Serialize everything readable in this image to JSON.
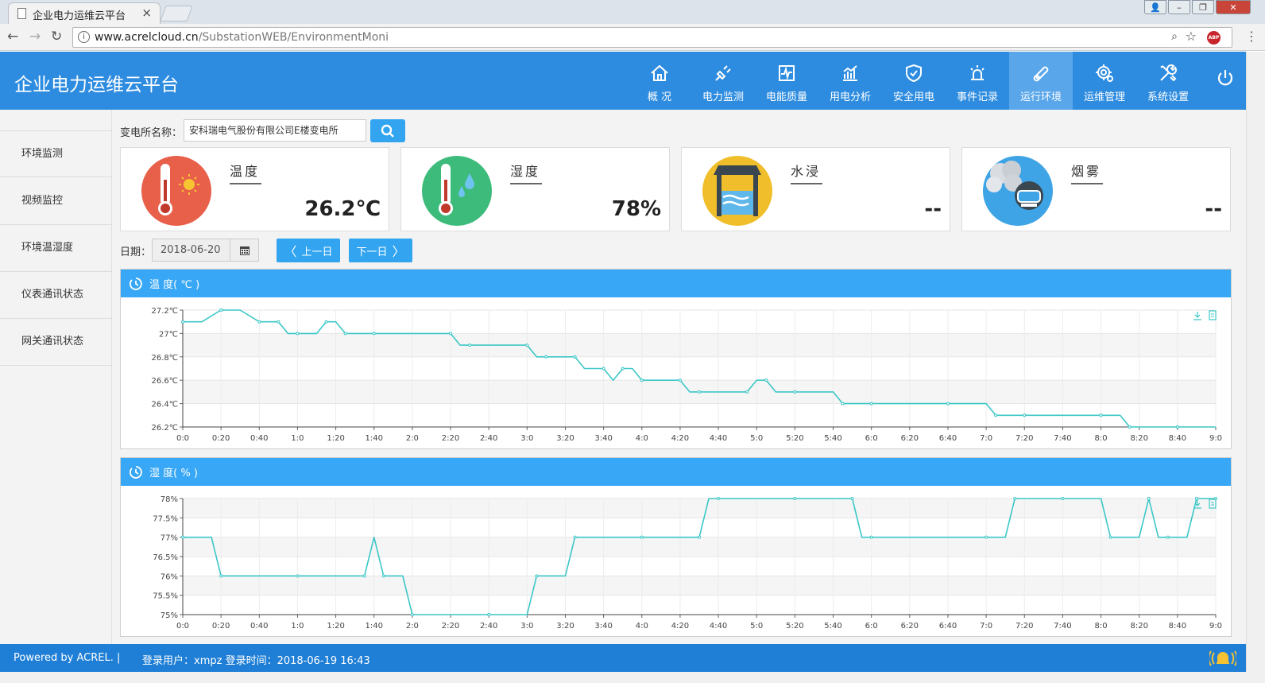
{
  "browser": {
    "tab_title": "企业电力运维云平台",
    "tab_close": "×",
    "url_host": "www.acrelcloud.cn",
    "url_path": "/SubstationWEB/EnvironmentMoni",
    "abp_label": "ABP"
  },
  "header": {
    "title": "企业电力运维云平台",
    "menu": [
      {
        "label": "概 况",
        "icon": "home-icon"
      },
      {
        "label": "电力监测",
        "icon": "plug-icon"
      },
      {
        "label": "电能质量",
        "icon": "waveform-icon"
      },
      {
        "label": "用电分析",
        "icon": "bar-chart-icon"
      },
      {
        "label": "安全用电",
        "icon": "shield-check-icon"
      },
      {
        "label": "事件记录",
        "icon": "alarm-light-icon"
      },
      {
        "label": "运行环境",
        "icon": "sensor-icon",
        "active": true
      },
      {
        "label": "运维管理",
        "icon": "gear-people-icon"
      },
      {
        "label": "系统设置",
        "icon": "tools-icon"
      }
    ]
  },
  "sidebar": {
    "items": [
      {
        "label": "环境监测",
        "active": true
      },
      {
        "label": "视频监控"
      },
      {
        "label": "环境温湿度"
      },
      {
        "label": "仪表通讯状态"
      },
      {
        "label": "网关通讯状态"
      }
    ]
  },
  "filter": {
    "substation_label": "变电所名称：",
    "substation_value": "安科瑞电气股份有限公司E楼变电所",
    "date_label": "日期：",
    "date_value": "2018-06-20",
    "prev_label": "上一日",
    "next_label": "下一日"
  },
  "cards": [
    {
      "title": "温度",
      "value": "26.2℃",
      "color": "#e8604a",
      "icon": "thermometer-sun-icon"
    },
    {
      "title": "湿度",
      "value": "78%",
      "color": "#3dbb7a",
      "icon": "thermometer-drops-icon"
    },
    {
      "title": "水浸",
      "value": "--",
      "color": "#f0be2a",
      "icon": "water-tank-icon"
    },
    {
      "title": "烟雾",
      "value": "--",
      "color": "#3ea4e6",
      "icon": "smoke-detector-icon"
    }
  ],
  "charts": {
    "temperature_title": "温 度( ℃ )",
    "humidity_title": "湿 度( % )"
  },
  "chart_data": [
    {
      "type": "line",
      "title": "温 度( ℃ )",
      "y_labels": [
        "26.2℃",
        "26.4℃",
        "26.6℃",
        "26.8℃",
        "27℃",
        "27.2℃"
      ],
      "ylim": [
        26.2,
        27.2
      ],
      "x_labels": [
        "0:0",
        "0:20",
        "0:40",
        "1:0",
        "1:20",
        "1:40",
        "2:0",
        "2:20",
        "2:40",
        "3:0",
        "3:20",
        "3:40",
        "4:0",
        "4:20",
        "4:40",
        "5:0",
        "5:20",
        "5:40",
        "6:0",
        "6:20",
        "6:40",
        "7:0",
        "7:20",
        "7:40",
        "8:0",
        "8:20",
        "8:40",
        "9:0"
      ],
      "color": "#3cc7c6",
      "series": [
        {
          "x": [
            "0:0",
            "0:10",
            "0:20",
            "0:30",
            "0:40",
            "0:45",
            "0:50",
            "0:55",
            "1:0",
            "1:10",
            "1:15",
            "1:20",
            "1:25",
            "1:30",
            "1:40",
            "2:0",
            "2:20",
            "2:25",
            "2:30",
            "2:40",
            "3:0",
            "3:05",
            "3:10",
            "3:20",
            "3:25",
            "3:30",
            "3:40",
            "3:45",
            "3:50",
            "3:55",
            "4:0",
            "4:05",
            "4:20",
            "4:25",
            "4:30",
            "4:40",
            "4:55",
            "5:0",
            "5:05",
            "5:10",
            "5:20",
            "5:40",
            "5:45",
            "5:50",
            "6:0",
            "6:20",
            "6:40",
            "7:0",
            "7:05",
            "7:10",
            "7:20",
            "7:40",
            "8:0",
            "8:10",
            "8:15",
            "8:20",
            "8:40",
            "9:0"
          ],
          "y": [
            27.1,
            27.1,
            27.2,
            27.2,
            27.1,
            27.1,
            27.1,
            27.0,
            27.0,
            27.0,
            27.1,
            27.1,
            27.0,
            27.0,
            27.0,
            27.0,
            27.0,
            26.9,
            26.9,
            26.9,
            26.9,
            26.8,
            26.8,
            26.8,
            26.8,
            26.7,
            26.7,
            26.6,
            26.7,
            26.7,
            26.6,
            26.6,
            26.6,
            26.5,
            26.5,
            26.5,
            26.5,
            26.6,
            26.6,
            26.5,
            26.5,
            26.5,
            26.4,
            26.4,
            26.4,
            26.4,
            26.4,
            26.4,
            26.3,
            26.3,
            26.3,
            26.3,
            26.3,
            26.3,
            26.2,
            26.2,
            26.2,
            26.2
          ]
        }
      ]
    },
    {
      "type": "line",
      "title": "湿 度( % )",
      "y_labels": [
        "75%",
        "75.5%",
        "76%",
        "76.5%",
        "77%",
        "77.5%",
        "78%"
      ],
      "ylim": [
        75,
        78
      ],
      "x_labels": [
        "0:0",
        "0:20",
        "0:40",
        "1:0",
        "1:20",
        "1:40",
        "2:0",
        "2:20",
        "2:40",
        "3:0",
        "3:20",
        "3:40",
        "4:0",
        "4:20",
        "4:40",
        "5:0",
        "5:20",
        "5:40",
        "6:0",
        "6:20",
        "6:40",
        "7:0",
        "7:20",
        "7:40",
        "8:0",
        "8:20",
        "8:40",
        "9:0"
      ],
      "color": "#3cc7c6",
      "series": [
        {
          "x": [
            "0:0",
            "0:15",
            "0:20",
            "0:40",
            "1:0",
            "1:20",
            "1:35",
            "1:40",
            "1:45",
            "1:55",
            "2:0",
            "2:20",
            "2:40",
            "3:0",
            "3:05",
            "3:20",
            "3:25",
            "3:40",
            "4:0",
            "4:20",
            "4:30",
            "4:35",
            "4:40",
            "5:0",
            "5:20",
            "5:40",
            "5:50",
            "5:55",
            "6:0",
            "6:40",
            "7:0",
            "7:10",
            "7:15",
            "7:20",
            "7:40",
            "8:0",
            "8:05",
            "8:20",
            "8:25",
            "8:30",
            "8:35",
            "8:45",
            "8:50",
            "8:55",
            "9:0"
          ],
          "y": [
            77,
            77,
            76,
            76,
            76,
            76,
            76,
            77,
            76,
            76,
            75,
            75,
            75,
            75,
            76,
            76,
            77,
            77,
            77,
            77,
            77,
            78,
            78,
            78,
            78,
            78,
            78,
            77,
            77,
            77,
            77,
            77,
            78,
            78,
            78,
            78,
            77,
            77,
            78,
            77,
            77,
            77,
            78,
            78,
            78
          ]
        }
      ]
    }
  ],
  "footer": {
    "powered": "Powered by ACREL.  |",
    "user": "登录用户：xmpz    登录时间：2018-06-19 16:43"
  }
}
